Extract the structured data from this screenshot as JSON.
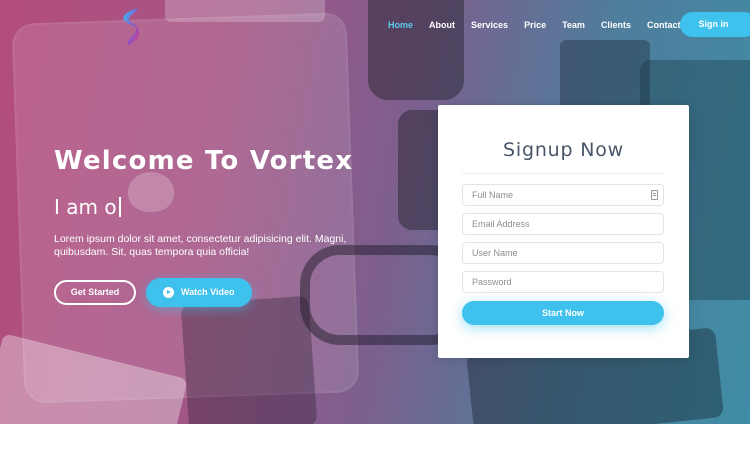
{
  "nav": {
    "items": [
      {
        "label": "Home",
        "active": true
      },
      {
        "label": "About"
      },
      {
        "label": "Services"
      },
      {
        "label": "Price"
      },
      {
        "label": "Team"
      },
      {
        "label": "Clients"
      },
      {
        "label": "Contact"
      }
    ],
    "signin_label": "Sign in"
  },
  "hero": {
    "title": "Welcome To Vortex",
    "typed_text": "I am o",
    "lead": "Lorem ipsum dolor sit amet, consectetur adipisicing elit. Magni, quibusdam. Sit, quas tempora quia officia!",
    "primary_button": "Get Started",
    "video_button": "Watch Video"
  },
  "signup": {
    "title": "Signup Now",
    "fields": [
      {
        "placeholder": "Full Name"
      },
      {
        "placeholder": "Email Address"
      },
      {
        "placeholder": "User Name"
      },
      {
        "placeholder": "Password"
      }
    ],
    "submit_label": "Start Now"
  },
  "colors": {
    "accent": "#3ec1ec",
    "gradient_left": "#b44d7c",
    "gradient_right": "#3f8da6",
    "card_title": "#4a5668"
  },
  "icons": {
    "logo": "brand-logo-icon",
    "play": "play-icon",
    "field_contact": "contact-card-icon"
  }
}
